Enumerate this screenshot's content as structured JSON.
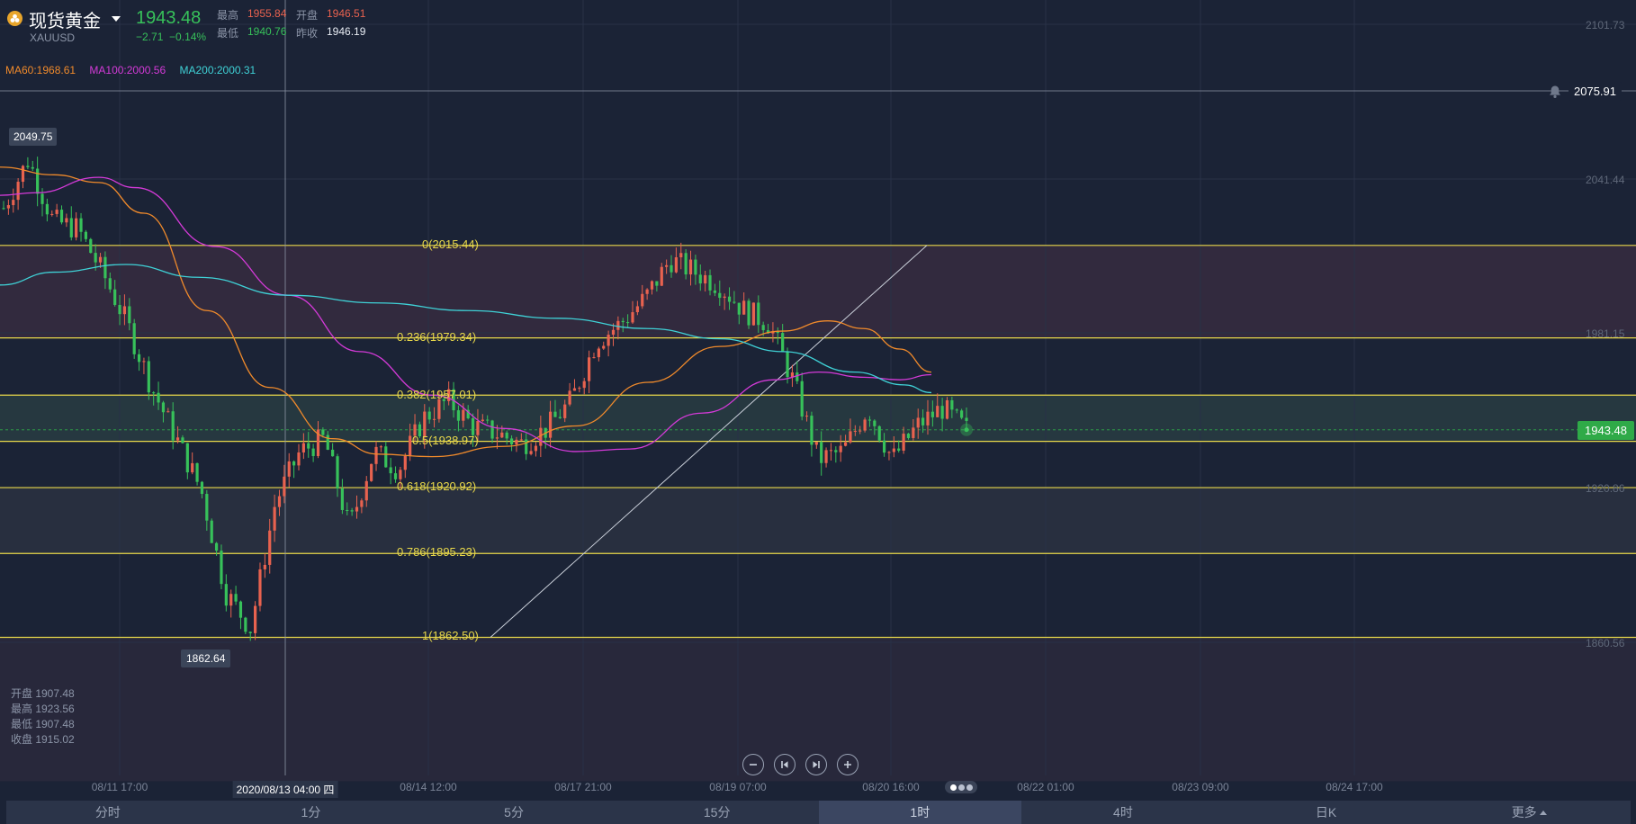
{
  "header": {
    "symbol_name": "现货黄金",
    "symbol_code": "XAUUSD",
    "last_price": "1943.48",
    "change": "−2.71",
    "change_pct": "−0.14%",
    "high_label": "最高",
    "high_value": "1955.84",
    "open_label": "开盘",
    "open_value": "1946.51",
    "low_label": "最低",
    "low_value": "1940.76",
    "prev_label": "昨收",
    "prev_value": "1946.19"
  },
  "indicators": [
    {
      "label": "MA60:1968.61",
      "color": "#f08a2b"
    },
    {
      "label": "MA100:2000.56",
      "color": "#d43ad8"
    },
    {
      "label": "MA200:2000.31",
      "color": "#3fd1d6"
    }
  ],
  "price_axis": [
    "2101.73",
    "2041.44",
    "1981.15",
    "1920.86",
    "1860.56"
  ],
  "crosshair_price": "2075.91",
  "current_price_tag": "1943.48",
  "peak_label": "2049.75",
  "trough_label": "1862.64",
  "fib_levels": [
    {
      "label": "0(2015.44)",
      "price": 2015.44
    },
    {
      "label": "0.236(1979.34)",
      "price": 1979.34
    },
    {
      "label": "0.382(1957.01)",
      "price": 1957.01
    },
    {
      "label": "0.5(1938.97)",
      "price": 1938.97
    },
    {
      "label": "0.618(1920.92)",
      "price": 1920.92
    },
    {
      "label": "0.786(1895.23)",
      "price": 1895.23
    },
    {
      "label": "1(1862.50)",
      "price": 1862.5
    }
  ],
  "time_axis": [
    "08/11 17:00",
    "08/14 12:00",
    "08/17 21:00",
    "08/19 07:00",
    "08/20 16:00",
    "08/22 01:00",
    "08/23 09:00",
    "08/24 17:00"
  ],
  "crosshair_time": "2020/08/13 04:00 四",
  "ohlc_box": {
    "open": "开盘 1907.48",
    "high": "最高 1923.56",
    "low": "最低 1907.48",
    "close": "收盘 1915.02"
  },
  "tabs": [
    {
      "label": "分时",
      "active": false
    },
    {
      "label": "1分",
      "active": false
    },
    {
      "label": "5分",
      "active": false
    },
    {
      "label": "15分",
      "active": false
    },
    {
      "label": "1时",
      "active": true
    },
    {
      "label": "4时",
      "active": false
    },
    {
      "label": "日K",
      "active": false
    },
    {
      "label": "更多",
      "active": false
    }
  ],
  "colors": {
    "background": "#1b2336",
    "up": "#e8624f",
    "down": "#37c15a",
    "fib": "#e8d84a"
  },
  "icons": [
    "gold-coin-icon",
    "bell-icon",
    "zoom-out-icon",
    "jump-start-icon",
    "jump-end-icon",
    "zoom-in-icon"
  ],
  "chart_data": {
    "type": "candlestick",
    "price_ticks": [
      2101.73,
      2041.44,
      1981.15,
      1920.86,
      1860.56
    ],
    "close_path": [
      [
        "08/11 11:00",
        2030
      ],
      [
        "08/11 15:00",
        2049
      ],
      [
        "08/11 19:00",
        2025
      ],
      [
        "08/11 23:00",
        2022
      ],
      [
        "08/12 04:00",
        2005
      ],
      [
        "08/12 08:00",
        1985
      ],
      [
        "08/12 12:00",
        1960
      ],
      [
        "08/12 16:00",
        1940
      ],
      [
        "08/12 20:00",
        1920
      ],
      [
        "08/12 23:00",
        1880
      ],
      [
        "08/13 02:00",
        1866
      ],
      [
        "08/13 04:00",
        1915
      ],
      [
        "08/13 08:00",
        1935
      ],
      [
        "08/13 14:00",
        1940
      ],
      [
        "08/13 20:00",
        1905
      ],
      [
        "08/14 02:00",
        1935
      ],
      [
        "08/14 08:00",
        1928
      ],
      [
        "08/14 12:00",
        1948
      ],
      [
        "08/14 16:00",
        1955
      ],
      [
        "08/14 22:00",
        1945
      ],
      [
        "08/17 02:00",
        1942
      ],
      [
        "08/17 08:00",
        1938
      ],
      [
        "08/17 14:00",
        1944
      ],
      [
        "08/17 20:00",
        1955
      ],
      [
        "08/18 00:00",
        1978
      ],
      [
        "08/18 06:00",
        1985
      ],
      [
        "08/18 12:00",
        1995
      ],
      [
        "08/18 18:00",
        2010
      ],
      [
        "08/18 22:00",
        2005
      ],
      [
        "08/19 04:00",
        2000
      ],
      [
        "08/19 10:00",
        1990
      ],
      [
        "08/19 16:00",
        1985
      ],
      [
        "08/19 20:00",
        1962
      ],
      [
        "08/19 22:00",
        1932
      ],
      [
        "08/20 02:00",
        1935
      ],
      [
        "08/20 08:00",
        1952
      ],
      [
        "08/20 12:00",
        1932
      ],
      [
        "08/20 16:00",
        1945
      ],
      [
        "08/20 20:00",
        1952
      ],
      [
        "08/20 22:00",
        1943.48
      ]
    ],
    "moving_averages": [
      {
        "name": "MA60",
        "value": 1968.61
      },
      {
        "name": "MA100",
        "value": 2000.56
      },
      {
        "name": "MA200",
        "value": 2000.31
      }
    ],
    "fib_retracement": {
      "high": 2015.44,
      "low": 1862.5
    }
  }
}
